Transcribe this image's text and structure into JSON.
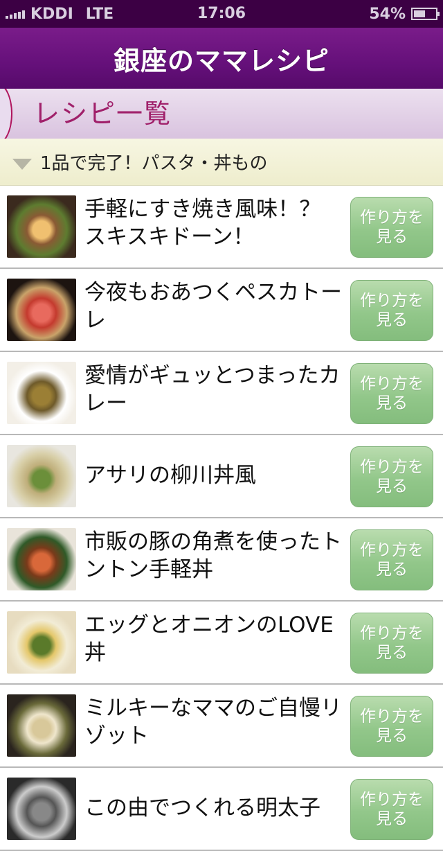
{
  "status_bar": {
    "carrier": "KDDI",
    "network": "LTE",
    "time": "17:06",
    "battery_text": "54%",
    "battery_level": 0.54
  },
  "nav": {
    "title": "銀座のママレシピ"
  },
  "banner": {
    "title": "レシピ一覧"
  },
  "category": {
    "label": "1品で完了！パスタ・丼もの"
  },
  "button_label": "作り方を見る",
  "recipes": [
    {
      "title": "手軽にすき焼き風味！？スキスキドーン！",
      "thumb_colors": [
        "#3b2a1e",
        "#8a5a34",
        "#f0c070",
        "#5e7c30"
      ]
    },
    {
      "title": "今夜もおあつくペスカトーレ",
      "thumb_colors": [
        "#1d1410",
        "#c43a2e",
        "#e86a5e",
        "#c9a36a"
      ]
    },
    {
      "title": "愛情がギュッとつまったカレー",
      "thumb_colors": [
        "#f3efe7",
        "#6e5a2a",
        "#9b7f35",
        "#ffffff"
      ]
    },
    {
      "title": "アサリの柳川丼風",
      "thumb_colors": [
        "#e8e6df",
        "#bfae7a",
        "#6b8f3a",
        "#d8cfa8"
      ]
    },
    {
      "title": "市販の豚の角煮を使ったトントン手軽丼",
      "thumb_colors": [
        "#e9e4da",
        "#7a3a1a",
        "#d9683a",
        "#2f5a28"
      ]
    },
    {
      "title": "エッグとオニオンのLOVE丼",
      "thumb_colors": [
        "#e7dcc0",
        "#e4c76a",
        "#5a7a2a",
        "#f2ecd6"
      ]
    },
    {
      "title": "ミルキーなママのご自慢リゾット",
      "thumb_colors": [
        "#2a241e",
        "#efe6cc",
        "#d8c89a",
        "#6a6a3a"
      ]
    },
    {
      "title": "この由でつくれる明太子",
      "thumb_colors": [
        "#2a2a2a",
        "#555",
        "#888",
        "#ccc"
      ]
    }
  ]
}
